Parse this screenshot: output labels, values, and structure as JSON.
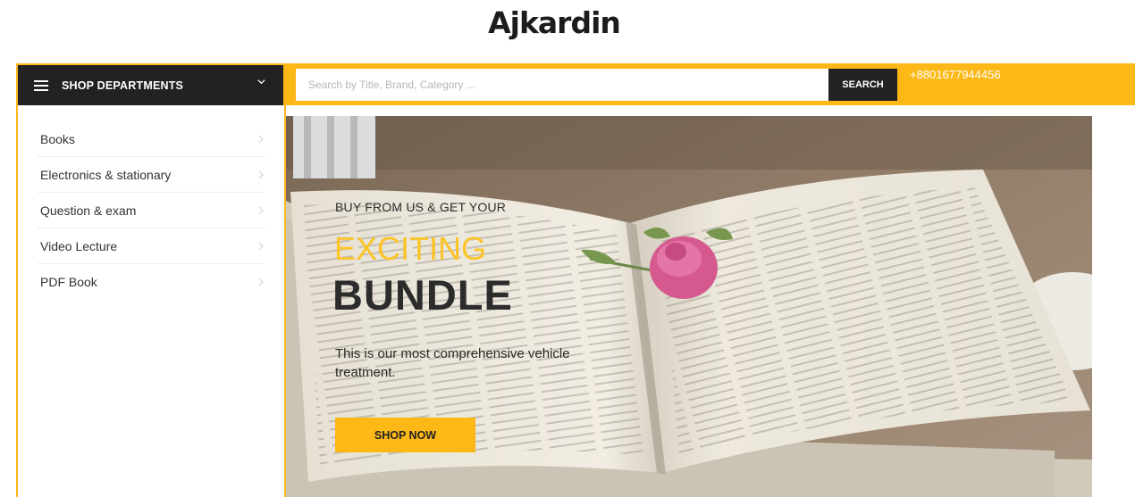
{
  "site": {
    "title": "Ajkardin"
  },
  "header": {
    "departments_label": "SHOP DEPARTMENTS",
    "search_placeholder": "Search by Title, Brand, Category ...",
    "search_value": "",
    "search_button": "SEARCH",
    "phone": "+8801677944456"
  },
  "sidebar": {
    "items": [
      {
        "label": "Books"
      },
      {
        "label": "Electronics & stationary"
      },
      {
        "label": "Question & exam"
      },
      {
        "label": "Video Lecture"
      },
      {
        "label": "PDF Book"
      }
    ]
  },
  "hero": {
    "eyebrow": "BUY FROM US & GET YOUR",
    "highlight": "EXCITING",
    "title": "BUNDLE",
    "description": "This is our most comprehensive vehicle treatment.",
    "button": "SHOP NOW"
  },
  "icons": {
    "menu": "hamburger-menu-icon",
    "dropdown": "chevron-down-icon",
    "category_arrow": "chevron-right-icon"
  },
  "colors": {
    "accent": "#fcb817",
    "dark": "#222222",
    "highlight_text": "#fcc428"
  }
}
